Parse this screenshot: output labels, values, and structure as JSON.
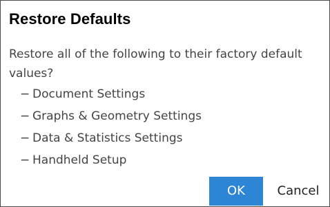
{
  "dialog": {
    "title": "Restore Defaults",
    "message": "Restore all of the following to their factory default values?",
    "items": [
      "Document Settings",
      "Graphs & Geometry Settings",
      "Data & Statistics Settings",
      "Handheld Setup"
    ],
    "item_prefix": "−",
    "buttons": {
      "ok_label": "OK",
      "cancel_label": "Cancel"
    },
    "colors": {
      "ok_button": "#2d85d5",
      "text": "#444444",
      "title": "#000000"
    }
  }
}
